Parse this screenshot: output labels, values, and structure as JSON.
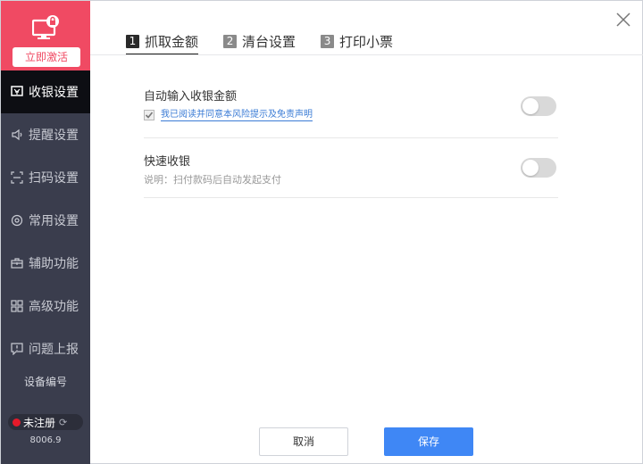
{
  "brand": {
    "activate_label": "立即激活",
    "color": "#f04a63"
  },
  "sidebar": {
    "items": [
      {
        "label": "收银设置",
        "icon": "cashier-icon",
        "active": true
      },
      {
        "label": "提醒设置",
        "icon": "speaker-icon",
        "active": false
      },
      {
        "label": "扫码设置",
        "icon": "scan-icon",
        "active": false
      },
      {
        "label": "常用设置",
        "icon": "gear-icon",
        "active": false
      },
      {
        "label": "辅助功能",
        "icon": "toolbox-icon",
        "active": false
      },
      {
        "label": "高级功能",
        "icon": "grid-icon",
        "active": false
      },
      {
        "label": "问题上报",
        "icon": "report-icon",
        "active": false
      }
    ],
    "device_label": "设备编号",
    "status_label": "未注册",
    "version": "8006.9"
  },
  "tabs": [
    {
      "num": "1",
      "label": "抓取金额",
      "active": true
    },
    {
      "num": "2",
      "label": "清台设置",
      "active": false
    },
    {
      "num": "3",
      "label": "打印小票",
      "active": false
    }
  ],
  "settings": {
    "auto_amount": {
      "title": "自动输入收银金额",
      "agree_label": "我已阅读并同意本风险提示及免责声明",
      "agree_checked": true,
      "enabled": false
    },
    "quick_pay": {
      "title": "快速收银",
      "desc": "说明：扫付款码后自动发起支付",
      "enabled": false
    }
  },
  "footer": {
    "cancel_label": "取消",
    "save_label": "保存",
    "accent": "#3f87f5"
  }
}
